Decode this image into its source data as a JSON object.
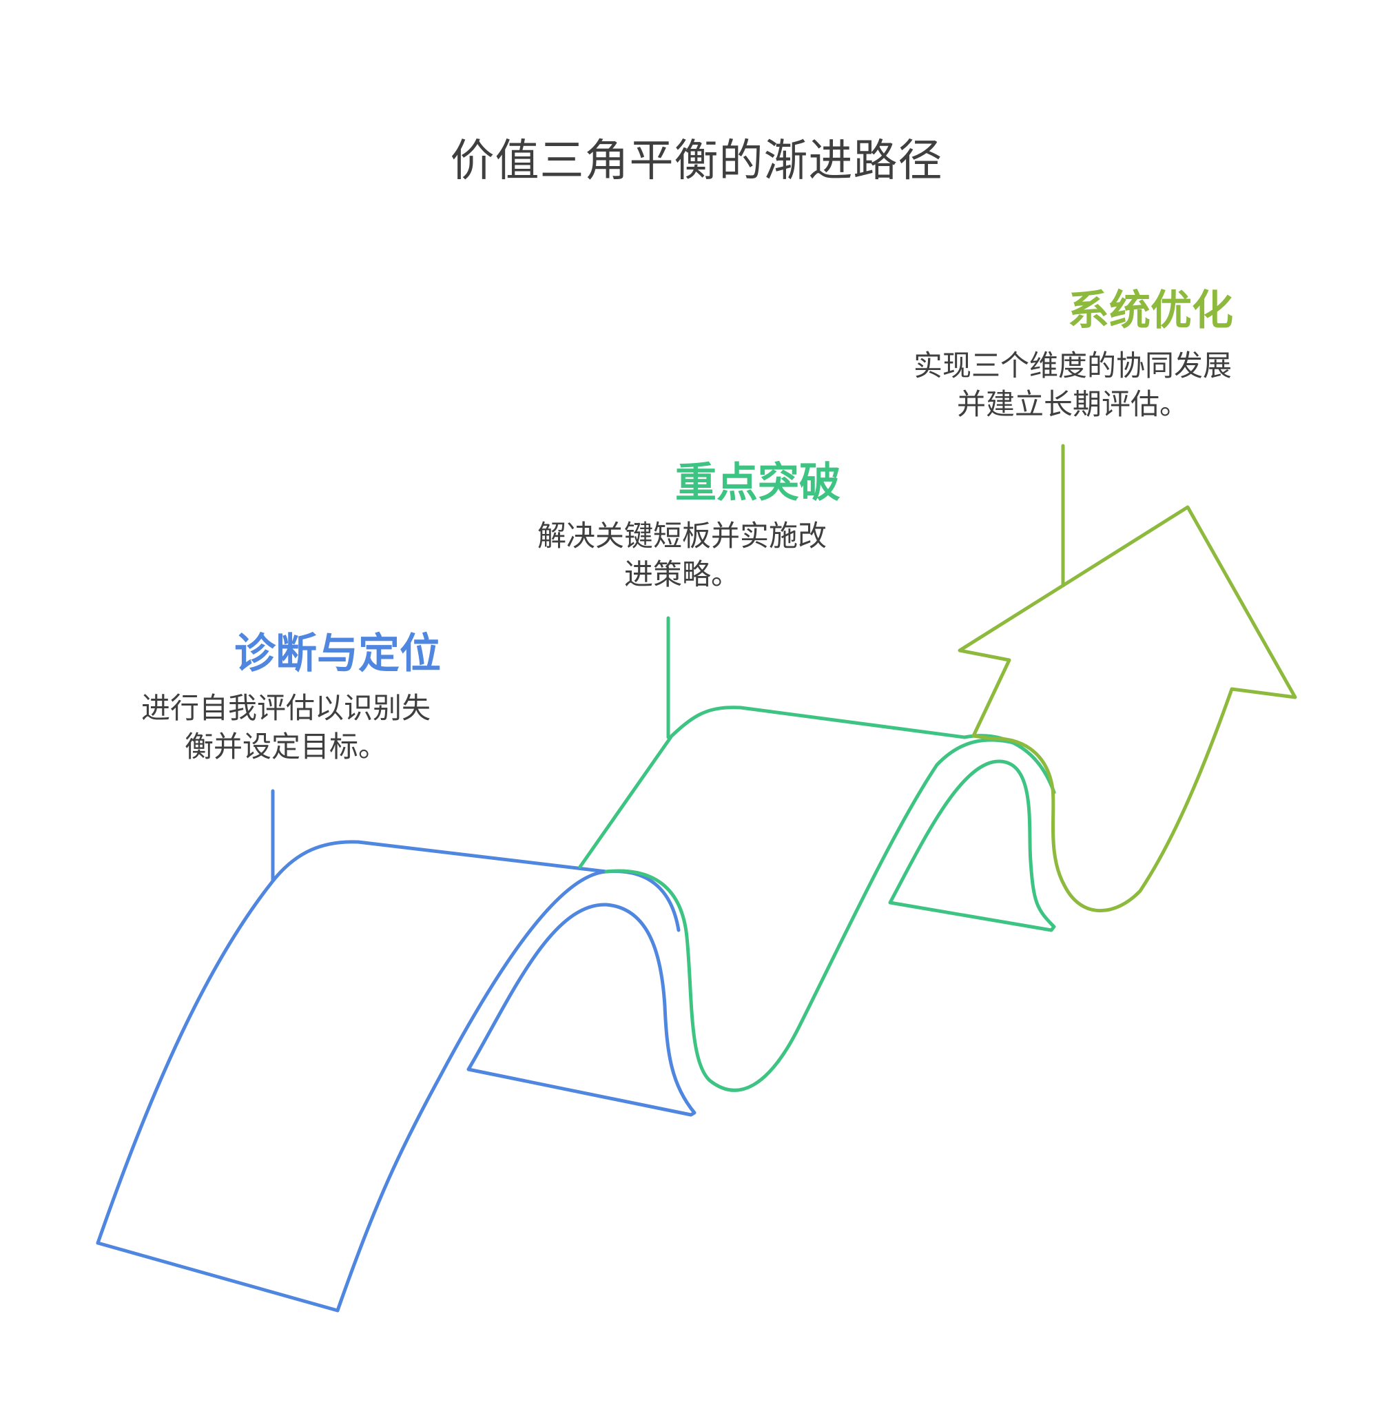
{
  "title": "价值三角平衡的渐进路径",
  "colors": {
    "blue": "#4f86e0",
    "green": "#3ec482",
    "lime": "#8dba3c",
    "text": "#3f3f3f"
  },
  "stages": [
    {
      "title": "诊断与定位",
      "description": "进行自我评估以识别失衡并设定目标。",
      "color": "#4f86e0"
    },
    {
      "title": "重点突破",
      "description": "解决关键短板并实施改进策略。",
      "color": "#3ec482"
    },
    {
      "title": "系统优化",
      "description": "实现三个维度的协同发展并建立长期评估。",
      "color": "#8dba3c"
    }
  ]
}
